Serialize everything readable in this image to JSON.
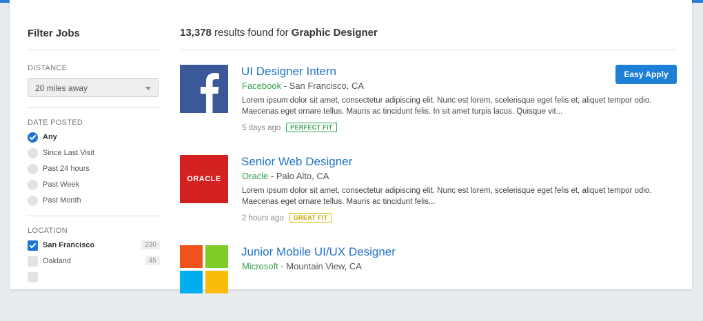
{
  "colors": {
    "accent": "#2d7bd3",
    "link": "#2272c4",
    "company": "#33a04a",
    "facebook": "#3b5998",
    "oracle": "#d2211f"
  },
  "sidebar": {
    "title": "Filter Jobs",
    "distance": {
      "label": "DISTANCE",
      "selected": "20 miles away"
    },
    "date_posted": {
      "label": "DATE POSTED",
      "options": [
        "Any",
        "Since Last Visit",
        "Past 24 hours",
        "Past Week",
        "Past Month"
      ],
      "selected": "Any"
    },
    "location": {
      "label": "LOCATION",
      "options": [
        {
          "label": "San Francisco",
          "count": "230",
          "checked": true
        },
        {
          "label": "Oakland",
          "count": "45",
          "checked": false
        }
      ]
    }
  },
  "main": {
    "results_count": "13,378",
    "results_text": " results found for ",
    "query": "Graphic Designer",
    "jobs": [
      {
        "title": "UI Designer Intern",
        "company": "Facebook",
        "location": " - San Francisco, CA",
        "description": "Lorem ipsum dolor sit amet, consectetur adipiscing elit. Nunc est lorem, scelerisque eget felis et, aliquet tempor odio. Maecenas eget ornare tellus. Mauris ac tincidunt felis. In sit amet turpis lacus. Quisque vit...",
        "posted": "5 days ago",
        "fit": "PERFECT FIT",
        "apply_label": "Easy Apply",
        "logo": "facebook-logo"
      },
      {
        "title": "Senior Web Designer",
        "company": "Oracle",
        "location": " - Palo Alto, CA",
        "description": "Lorem ipsum dolor sit amet, consectetur adipiscing elit. Nunc est lorem, scelerisque eget felis et, aliquet tempor odio. Maecenas eget ornare tellus. Mauris ac tincidunt felis...",
        "posted": "2 hours ago",
        "fit": "GREAT FIT",
        "logo": "oracle-logo",
        "logo_text": "ORACLE"
      },
      {
        "title": "Junior Mobile UI/UX Designer",
        "company": "Microsoft",
        "location": " - Mountain View, CA",
        "logo": "microsoft-logo"
      }
    ]
  }
}
